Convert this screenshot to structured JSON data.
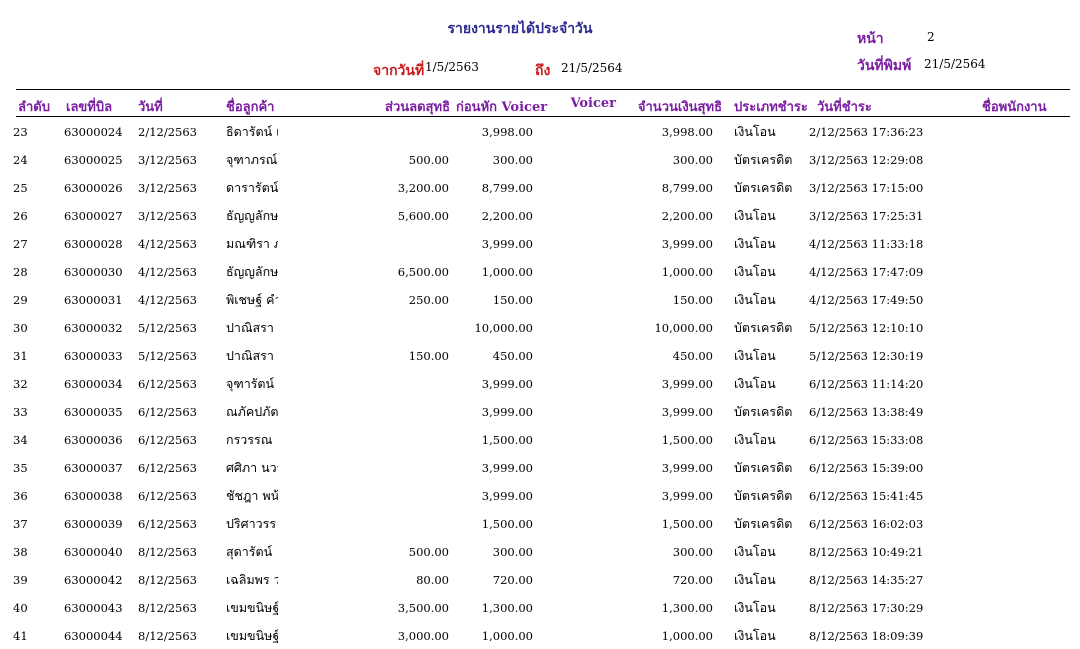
{
  "report": {
    "title": "รายงานรายได้ประจำวัน",
    "page_label": "หน้า",
    "page_value": "2",
    "print_date_label": "วันที่พิมพ์",
    "print_date_value": "21/5/2564",
    "from_label": "จากวันที่",
    "from_value": "1/5/2563",
    "to_label": "ถึง",
    "to_value": "21/5/2564"
  },
  "columns": {
    "seq": "ลำดับ",
    "bill_no": "เลขที่บิล",
    "date": "วันที่",
    "customer": "ชื่อลูกค้า",
    "discount": "ส่วนลดสุทธิ",
    "before_voucher": "ก่อนหัก Voicer",
    "voucher": "Voicer",
    "net_amount": "จำนวนเงินสุทธิ",
    "payment_type": "ประเภทชำระ",
    "paid_date": "วันที่ชำระ",
    "employee": "ชื่อพนักงาน"
  },
  "rows": [
    {
      "seq": "23",
      "bill": "63000024",
      "date": "2/12/2563",
      "customer": "ธิดารัตน์ แ",
      "discount": "",
      "before": "3,998.00",
      "voucher": "",
      "net": "3,998.00",
      "type": "เงินโอน",
      "paid": "2/12/2563 17:36:23",
      "employee": ""
    },
    {
      "seq": "24",
      "bill": "63000025",
      "date": "3/12/2563",
      "customer": "จุฑาภรณ์",
      "discount": "500.00",
      "before": "300.00",
      "voucher": "",
      "net": "300.00",
      "type": "บัตรเครดิต",
      "paid": "3/12/2563 12:29:08",
      "employee": ""
    },
    {
      "seq": "25",
      "bill": "63000026",
      "date": "3/12/2563",
      "customer": "ดารารัตน์",
      "discount": "3,200.00",
      "before": "8,799.00",
      "voucher": "",
      "net": "8,799.00",
      "type": "บัตรเครดิต",
      "paid": "3/12/2563 17:15:00",
      "employee": ""
    },
    {
      "seq": "26",
      "bill": "63000027",
      "date": "3/12/2563",
      "customer": "ธัญญลักษ",
      "discount": "5,600.00",
      "before": "2,200.00",
      "voucher": "",
      "net": "2,200.00",
      "type": "เงินโอน",
      "paid": "3/12/2563 17:25:31",
      "employee": ""
    },
    {
      "seq": "27",
      "bill": "63000028",
      "date": "4/12/2563",
      "customer": "มณฑิรา ภ",
      "discount": "",
      "before": "3,999.00",
      "voucher": "",
      "net": "3,999.00",
      "type": "เงินโอน",
      "paid": "4/12/2563 11:33:18",
      "employee": ""
    },
    {
      "seq": "28",
      "bill": "63000030",
      "date": "4/12/2563",
      "customer": "ธัญญลักษ",
      "discount": "6,500.00",
      "before": "1,000.00",
      "voucher": "",
      "net": "1,000.00",
      "type": "เงินโอน",
      "paid": "4/12/2563 17:47:09",
      "employee": ""
    },
    {
      "seq": "29",
      "bill": "63000031",
      "date": "4/12/2563",
      "customer": "พิเชษฐ์ คำ",
      "discount": "250.00",
      "before": "150.00",
      "voucher": "",
      "net": "150.00",
      "type": "เงินโอน",
      "paid": "4/12/2563 17:49:50",
      "employee": ""
    },
    {
      "seq": "30",
      "bill": "63000032",
      "date": "5/12/2563",
      "customer": "ปาณิสรา เ",
      "discount": "",
      "before": "10,000.00",
      "voucher": "",
      "net": "10,000.00",
      "type": "บัตรเครดิต",
      "paid": "5/12/2563 12:10:10",
      "employee": ""
    },
    {
      "seq": "31",
      "bill": "63000033",
      "date": "5/12/2563",
      "customer": "ปาณิสรา เ",
      "discount": "150.00",
      "before": "450.00",
      "voucher": "",
      "net": "450.00",
      "type": "เงินโอน",
      "paid": "5/12/2563 12:30:19",
      "employee": ""
    },
    {
      "seq": "32",
      "bill": "63000034",
      "date": "6/12/2563",
      "customer": "จุฑารัตน์",
      "discount": "",
      "before": "3,999.00",
      "voucher": "",
      "net": "3,999.00",
      "type": "เงินโอน",
      "paid": "6/12/2563 11:14:20",
      "employee": ""
    },
    {
      "seq": "33",
      "bill": "63000035",
      "date": "6/12/2563",
      "customer": "ณภัคปภัต",
      "discount": "",
      "before": "3,999.00",
      "voucher": "",
      "net": "3,999.00",
      "type": "บัตรเครดิต",
      "paid": "6/12/2563 13:38:49",
      "employee": ""
    },
    {
      "seq": "34",
      "bill": "63000036",
      "date": "6/12/2563",
      "customer": "กรวรรณ",
      "discount": "",
      "before": "1,500.00",
      "voucher": "",
      "net": "1,500.00",
      "type": "เงินโอน",
      "paid": "6/12/2563 15:33:08",
      "employee": ""
    },
    {
      "seq": "35",
      "bill": "63000037",
      "date": "6/12/2563",
      "customer": "ศศิภา นวร",
      "discount": "",
      "before": "3,999.00",
      "voucher": "",
      "net": "3,999.00",
      "type": "บัตรเครดิต",
      "paid": "6/12/2563 15:39:00",
      "employee": ""
    },
    {
      "seq": "36",
      "bill": "63000038",
      "date": "6/12/2563",
      "customer": "ชัชฎา พน้",
      "discount": "",
      "before": "3,999.00",
      "voucher": "",
      "net": "3,999.00",
      "type": "บัตรเครดิต",
      "paid": "6/12/2563 15:41:45",
      "employee": ""
    },
    {
      "seq": "37",
      "bill": "63000039",
      "date": "6/12/2563",
      "customer": "ปริศาวรร",
      "discount": "",
      "before": "1,500.00",
      "voucher": "",
      "net": "1,500.00",
      "type": "บัตรเครดิต",
      "paid": "6/12/2563 16:02:03",
      "employee": ""
    },
    {
      "seq": "38",
      "bill": "63000040",
      "date": "8/12/2563",
      "customer": "สุดารัตน์",
      "discount": "500.00",
      "before": "300.00",
      "voucher": "",
      "net": "300.00",
      "type": "เงินโอน",
      "paid": "8/12/2563 10:49:21",
      "employee": ""
    },
    {
      "seq": "39",
      "bill": "63000042",
      "date": "8/12/2563",
      "customer": "เฉลิมพร ว",
      "discount": "80.00",
      "before": "720.00",
      "voucher": "",
      "net": "720.00",
      "type": "เงินโอน",
      "paid": "8/12/2563 14:35:27",
      "employee": ""
    },
    {
      "seq": "40",
      "bill": "63000043",
      "date": "8/12/2563",
      "customer": "เขมขนิษฐ์",
      "discount": "3,500.00",
      "before": "1,300.00",
      "voucher": "",
      "net": "1,300.00",
      "type": "เงินโอน",
      "paid": "8/12/2563 17:30:29",
      "employee": ""
    },
    {
      "seq": "41",
      "bill": "63000044",
      "date": "8/12/2563",
      "customer": "เขมขนิษฐ์",
      "discount": "3,000.00",
      "before": "1,000.00",
      "voucher": "",
      "net": "1,000.00",
      "type": "เงินโอน",
      "paid": "8/12/2563 18:09:39",
      "employee": ""
    }
  ]
}
